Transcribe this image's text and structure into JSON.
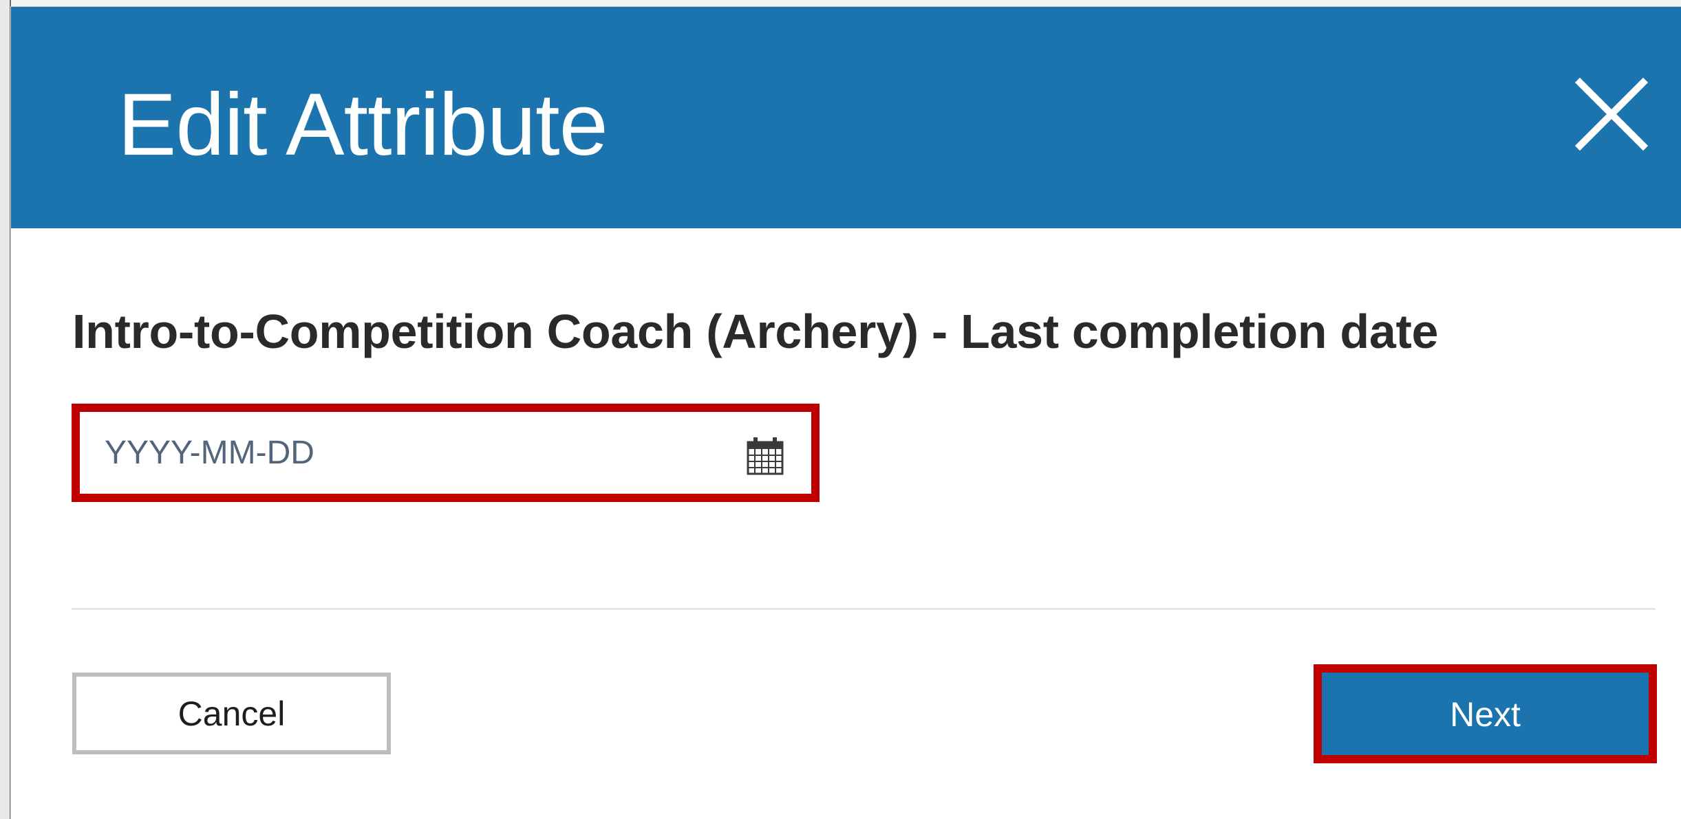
{
  "dialog": {
    "title": "Edit Attribute",
    "close_icon": "close-icon",
    "header_color": "#1b74ad"
  },
  "form": {
    "label": "Intro-to-Competition Coach (Archery) - Last completion date",
    "date_input": {
      "value": "",
      "placeholder": "YYYY-MM-DD",
      "icon": "calendar-icon"
    }
  },
  "actions": {
    "cancel_label": "Cancel",
    "next_label": "Next"
  },
  "colors": {
    "primary": "#1b74ad",
    "highlight_outline": "#c00000"
  }
}
